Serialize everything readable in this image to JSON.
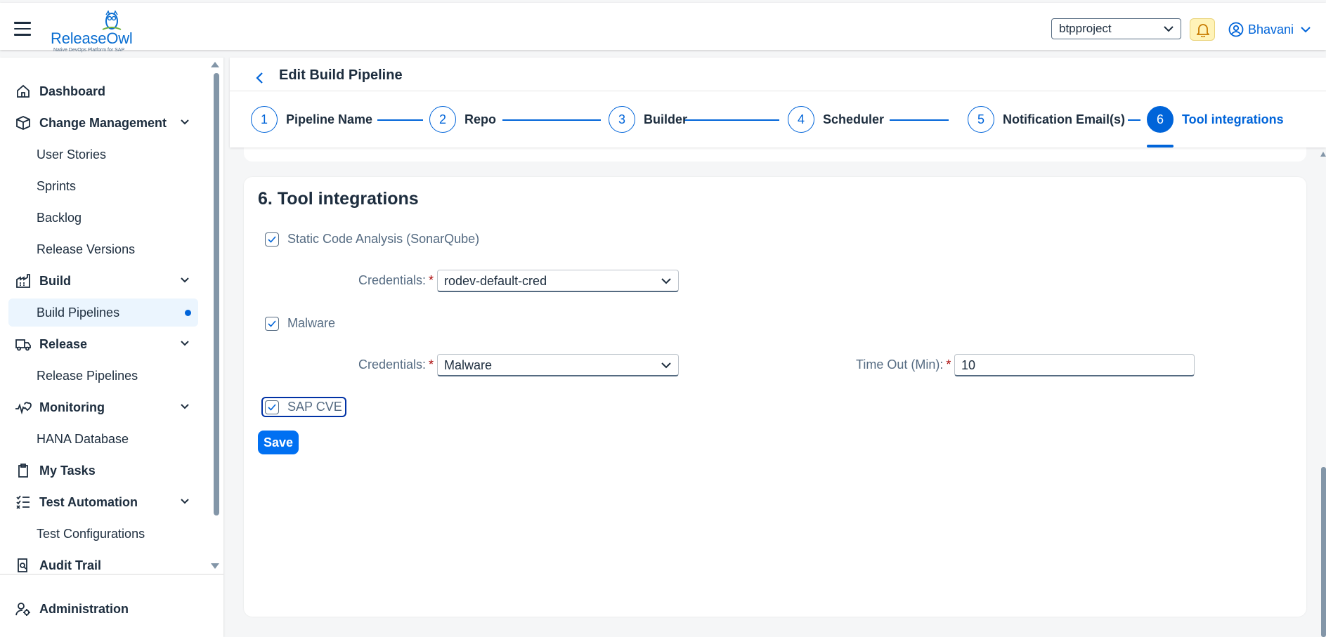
{
  "header": {
    "logo_text_release": "Release",
    "logo_text_owl": "Owl",
    "logo_tagline": "Native DevOps Platform for SAP",
    "project_select_value": "btpproject",
    "user_name": "Bhavani"
  },
  "sidebar": {
    "items": [
      {
        "label": "Dashboard",
        "icon": "home-icon"
      },
      {
        "label": "Change Management",
        "icon": "change-icon"
      },
      {
        "label": "User Stories"
      },
      {
        "label": "Sprints"
      },
      {
        "label": "Backlog"
      },
      {
        "label": "Release Versions"
      },
      {
        "label": "Build",
        "icon": "factory-icon"
      },
      {
        "label": "Build Pipelines",
        "selected": true
      },
      {
        "label": "Release",
        "icon": "truck-icon"
      },
      {
        "label": "Release Pipelines"
      },
      {
        "label": "Monitoring",
        "icon": "heart-monitor-icon"
      },
      {
        "label": "HANA Database"
      },
      {
        "label": "My Tasks",
        "icon": "clipboard-icon"
      },
      {
        "label": "Test Automation",
        "icon": "checklist-icon"
      },
      {
        "label": "Test Configurations"
      },
      {
        "label": "Audit Trail",
        "icon": "audit-icon"
      }
    ],
    "footer_item": "Administration"
  },
  "page": {
    "title": "Edit Build Pipeline",
    "steps": [
      {
        "num": "1",
        "label": "Pipeline Name"
      },
      {
        "num": "2",
        "label": "Repo"
      },
      {
        "num": "3",
        "label": "Builder"
      },
      {
        "num": "4",
        "label": "Scheduler"
      },
      {
        "num": "5",
        "label": "Notification Email(s)"
      },
      {
        "num": "6",
        "label": "Tool integrations",
        "active": true
      }
    ]
  },
  "form": {
    "section_title": "6. Tool integrations",
    "sonar_label": "Static Code Analysis (SonarQube)",
    "sonar_checked": true,
    "sonar_cred_label": "Credentials:",
    "sonar_cred_value": "rodev-default-cred",
    "malware_label": "Malware",
    "malware_checked": true,
    "malware_cred_label": "Credentials:",
    "malware_cred_value": "Malware",
    "timeout_label": "Time Out (Min):",
    "timeout_value": "10",
    "sapcve_label": "SAP CVE",
    "sapcve_checked": true,
    "required_mark": "*",
    "save_label": "Save"
  },
  "colors": {
    "accent": "#0064d9",
    "button": "#0070f2",
    "required": "#aa0808",
    "bell_bg": "#fff3b8"
  }
}
